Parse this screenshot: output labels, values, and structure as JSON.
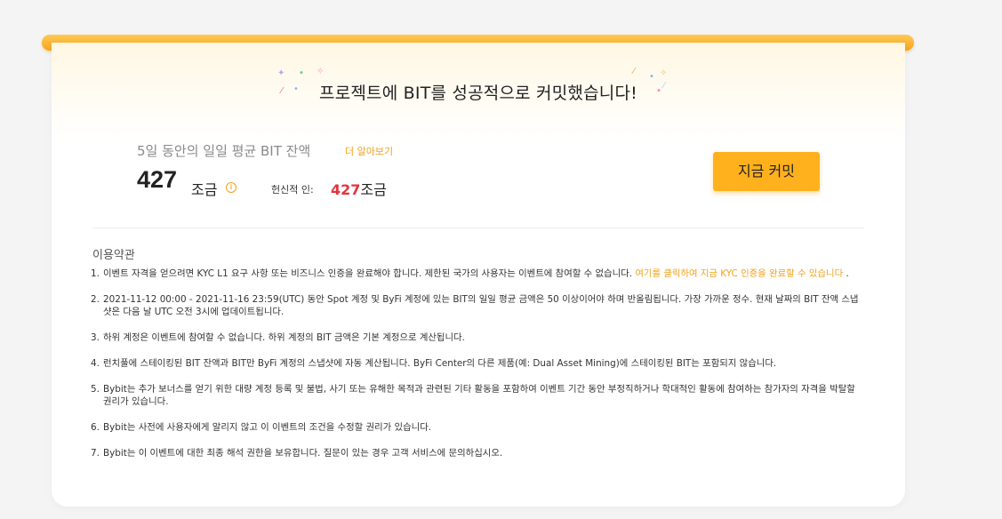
{
  "header": {
    "title": "프로젝트에 BIT를 성공적으로 커밋했습니다!"
  },
  "balance": {
    "label": "5일 동안의 일일 평균 BIT 잔액",
    "learn_more": "더 알아보기",
    "amount": "427",
    "unit": "조금",
    "info_icon": "info-circle",
    "contribution_label": "헌신적 인:",
    "contribution_value": "427",
    "contribution_unit": "조금"
  },
  "commit_button": "지금 커밋",
  "terms": {
    "title": "이용약관",
    "items": [
      {
        "index": "1.",
        "text": "이벤트 자격을 얻으려면 KYC L1 요구 사항 또는 비즈니스 인증을 완료해야 합니다. 제한된 국가의 사용자는 이벤트에 참여할 수 없습니다.",
        "link": "여기를 클릭하여 지금 KYC 인증을 완료할 수 있습니다",
        "suffix": " ."
      },
      {
        "index": "2.",
        "text": "2021-11-12 00:00 - 2021-11-16 23:59(UTC) 동안 Spot 계정 및 ByFi 계정에 있는 BIT의 일일 평균 금액은 50 이상이어야 하며 반올림됩니다. 가장 가까운 정수. 현재 날짜의 BIT 잔액 스냅샷은 다음 날 UTC 오전 3시에 업데이트됩니다."
      },
      {
        "index": "3.",
        "text": "하위 계정은 이벤트에 참여할 수 없습니다. 하위 계정의 BIT 금액은 기본 계정으로 계산됩니다."
      },
      {
        "index": "4.",
        "text": "런치풀에 스테이킹된 BIT 잔액과 BIT만 ByFi 계정의 스냅샷에 자동 계산됩니다. ByFi Center의 다른 제품(예: Dual Asset Mining)에 스테이킹된 BIT는 포함되지 않습니다."
      },
      {
        "index": "5.",
        "text": "Bybit는 추가 보너스를 얻기 위한 대량 계정 등록 및 불법, 사기 또는 유해한 목적과 관련된 기타 활동을 포함하여 이벤트 기간 동안 부정직하거나 학대적인 활동에 참여하는 참가자의 자격을 박탈할 권리가 있습니다."
      },
      {
        "index": "6.",
        "text": "Bybit는 사전에 사용자에게 알리지 않고 이 이벤트의 조건을 수정할 권리가 있습니다."
      },
      {
        "index": "7.",
        "text": "Bybit는 이 이벤트에 대한 최종 해석 권한을 보유합니다. 질문이 있는 경우 고객 서비스에 문의하십시오."
      }
    ]
  }
}
